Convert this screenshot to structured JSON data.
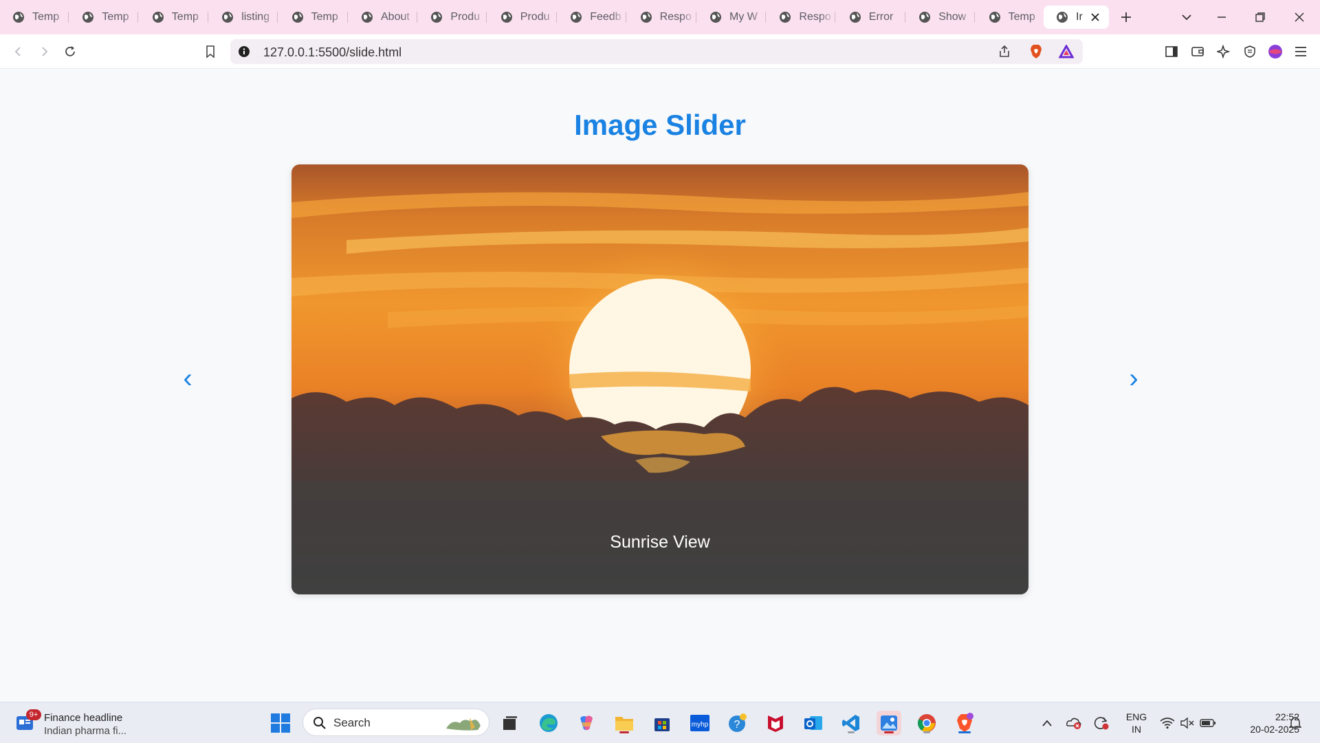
{
  "browser": {
    "tabs": [
      {
        "title": "Temp"
      },
      {
        "title": "Temp"
      },
      {
        "title": "Temp"
      },
      {
        "title": "listing"
      },
      {
        "title": "Temp"
      },
      {
        "title": "About"
      },
      {
        "title": "Produ"
      },
      {
        "title": "Produ"
      },
      {
        "title": "Feedb"
      },
      {
        "title": "Respo"
      },
      {
        "title": "My W"
      },
      {
        "title": "Respo"
      },
      {
        "title": "Error"
      },
      {
        "title": "Show"
      },
      {
        "title": "Temp"
      }
    ],
    "active_tab": {
      "title": "Ir"
    },
    "url": "127.0.0.1:5500/slide.html"
  },
  "page": {
    "title": "Image Slider",
    "slide": {
      "caption": "Sunrise View",
      "prev_symbol": "‹",
      "next_symbol": "›"
    }
  },
  "taskbar": {
    "news": {
      "badge": "9+",
      "headline": "Finance headline",
      "summary": "Indian pharma fi..."
    },
    "search_label": "Search",
    "lang_line1": "ENG",
    "lang_line2": "IN",
    "time": "22:52",
    "date": "20-02-2025"
  },
  "colors": {
    "accent": "#1a82e2",
    "tabstrip": "#fbe0ef",
    "page_bg": "#f8f9fb"
  }
}
